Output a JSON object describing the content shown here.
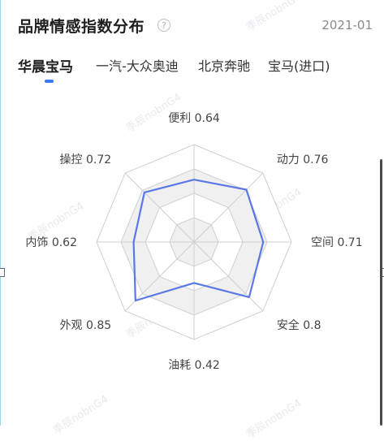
{
  "header": {
    "title": "品牌情感指数分布",
    "help_icon": "question-circle-icon",
    "date": "2021-01"
  },
  "tabs": [
    {
      "label": "华晨宝马",
      "active": true
    },
    {
      "label": "一汽-大众奥迪",
      "active": false
    },
    {
      "label": "北京奔驰",
      "active": false
    },
    {
      "label": "宝马(进口)",
      "active": false
    }
  ],
  "watermark": {
    "text": "季辰nobnG4"
  },
  "colors": {
    "accent": "#3a7af0",
    "series_line": "#5b78e6",
    "positive": "#3daa4f",
    "negative": "#e05555",
    "grid_fill": "#f0f0f0",
    "grid_line": "#cfcfcf"
  },
  "chart_data": {
    "type": "radar",
    "rmax": 1.0,
    "rings": 4,
    "axes": [
      {
        "label": "便利",
        "value": 0.64,
        "highlight": "none"
      },
      {
        "label": "动力",
        "value": 0.76,
        "highlight": "none"
      },
      {
        "label": "空间",
        "value": 0.71,
        "highlight": "none"
      },
      {
        "label": "安全",
        "value": 0.8,
        "highlight": "none"
      },
      {
        "label": "油耗",
        "value": 0.42,
        "highlight": "negative"
      },
      {
        "label": "外观",
        "value": 0.85,
        "highlight": "positive"
      },
      {
        "label": "内饰",
        "value": 0.62,
        "highlight": "none"
      },
      {
        "label": "操控",
        "value": 0.72,
        "highlight": "none"
      }
    ]
  }
}
